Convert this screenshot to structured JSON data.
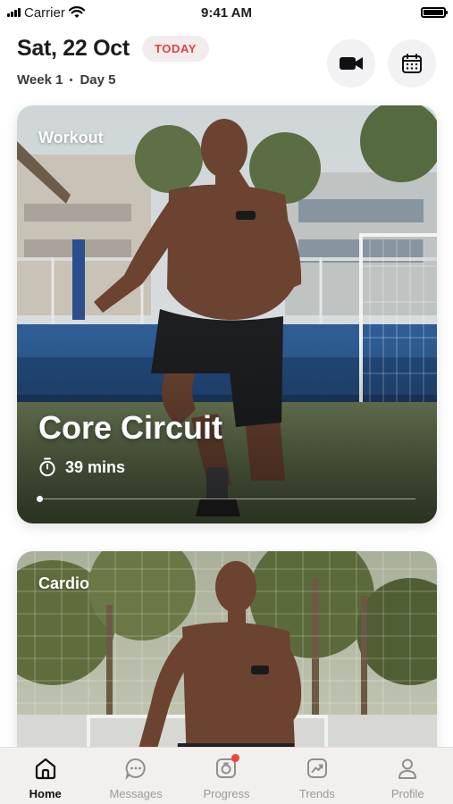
{
  "status_bar": {
    "carrier": "Carrier",
    "time": "9:41 AM"
  },
  "header": {
    "date": "Sat, 22 Oct",
    "badge": "TODAY",
    "week": "Week 1",
    "day": "Day 5",
    "actions": [
      {
        "icon": "video-camera-icon"
      },
      {
        "icon": "calendar-icon"
      }
    ]
  },
  "cards": [
    {
      "category": "Workout",
      "title": "Core Circuit",
      "duration": "39 mins",
      "progress": 0.0
    },
    {
      "category": "Cardio"
    }
  ],
  "tab_bar": {
    "items": [
      {
        "label": "Home",
        "icon": "home-icon",
        "active": true
      },
      {
        "label": "Messages",
        "icon": "chat-bubble-icon"
      },
      {
        "label": "Progress",
        "icon": "progress-camera-icon",
        "badge": true
      },
      {
        "label": "Trends",
        "icon": "trends-chart-icon"
      },
      {
        "label": "Profile",
        "icon": "user-icon"
      }
    ]
  },
  "colors": {
    "accent": "#e0413d",
    "badge_bg": "#f4ecec",
    "tab_bar_bg": "#f2efed",
    "notification": "#f0453a"
  }
}
